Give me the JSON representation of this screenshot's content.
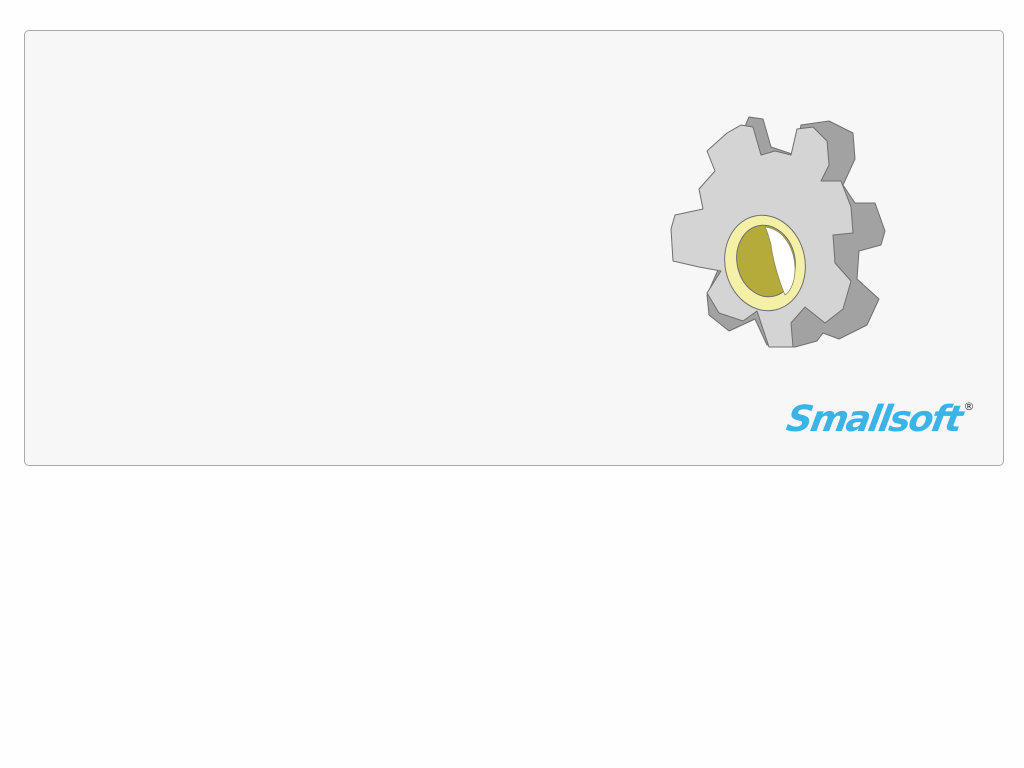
{
  "splash": {
    "graphic_icon": "gear-icon",
    "logo": {
      "name": "Smallsoft",
      "registered": "®",
      "color": "#3ab3e6"
    },
    "colors": {
      "panel_background": "#f7f7f7",
      "panel_border": "#a9a9a9",
      "gear_face": "#d4d4d4",
      "gear_side": "#a2a2a2",
      "gear_ring": "#f5f0a8",
      "gear_hole": "#b5ab3a"
    }
  }
}
